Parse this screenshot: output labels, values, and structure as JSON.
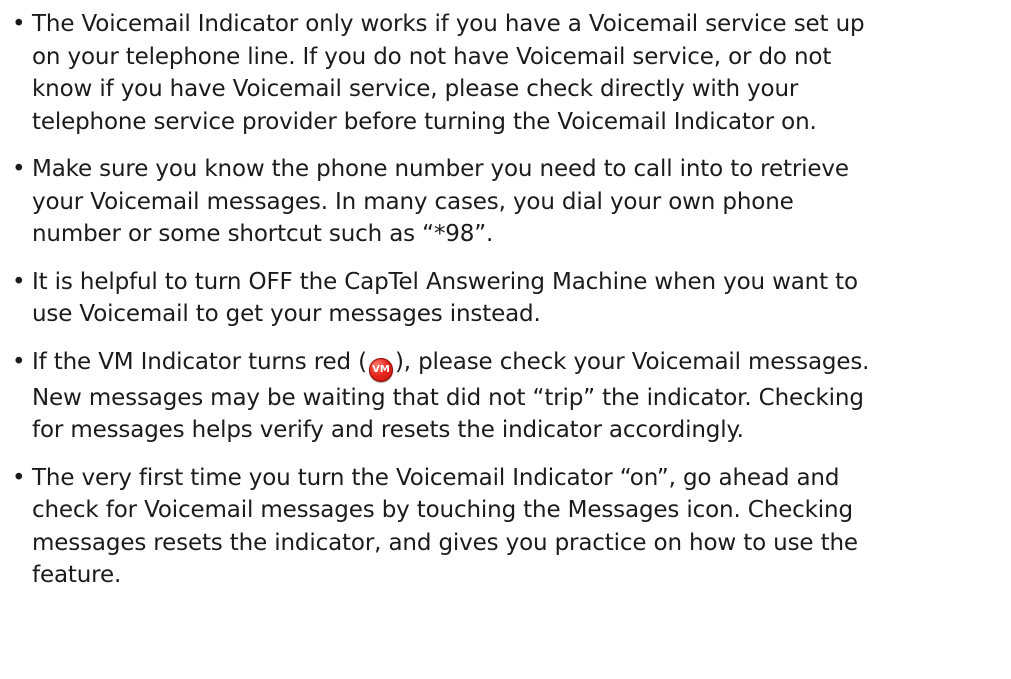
{
  "colors": {
    "text": "#1b1b1b",
    "vm_badge": "#e8261d"
  },
  "bullets": [
    {
      "lines": [
        "The Voicemail Indicator only works if you have a Voicemail service set up",
        "on your telephone line. If you do not have Voicemail service, or do not",
        "know if you have Voicemail service, please check directly with your",
        "telephone service provider before turning the Voicemail Indicator on."
      ]
    },
    {
      "lines": [
        "Make sure you know the phone number you need to call into to retrieve",
        "your Voicemail messages. In many cases, you dial your own phone",
        "number or some shortcut such as “*98”."
      ]
    },
    {
      "lines": [
        "It is helpful to turn OFF the CapTel Answering Machine when you want to",
        "use Voicemail to get your messages instead."
      ]
    },
    {
      "line1_before": "If the VM Indicator turns red (",
      "badge_label": "VM",
      "line1_after": "), please check your Voicemail messages.",
      "lines_rest": [
        "New messages may be waiting that did not “trip” the indicator. Checking",
        "for messages helps verify and resets the indicator accordingly."
      ]
    },
    {
      "lines": [
        "The very first time you turn the Voicemail Indicator “on”, go ahead and",
        "check for Voicemail messages by touching the Messages icon. Checking",
        "messages resets the indicator, and gives you practice on how to use the",
        "feature."
      ]
    }
  ],
  "bullet_glyph": "•"
}
